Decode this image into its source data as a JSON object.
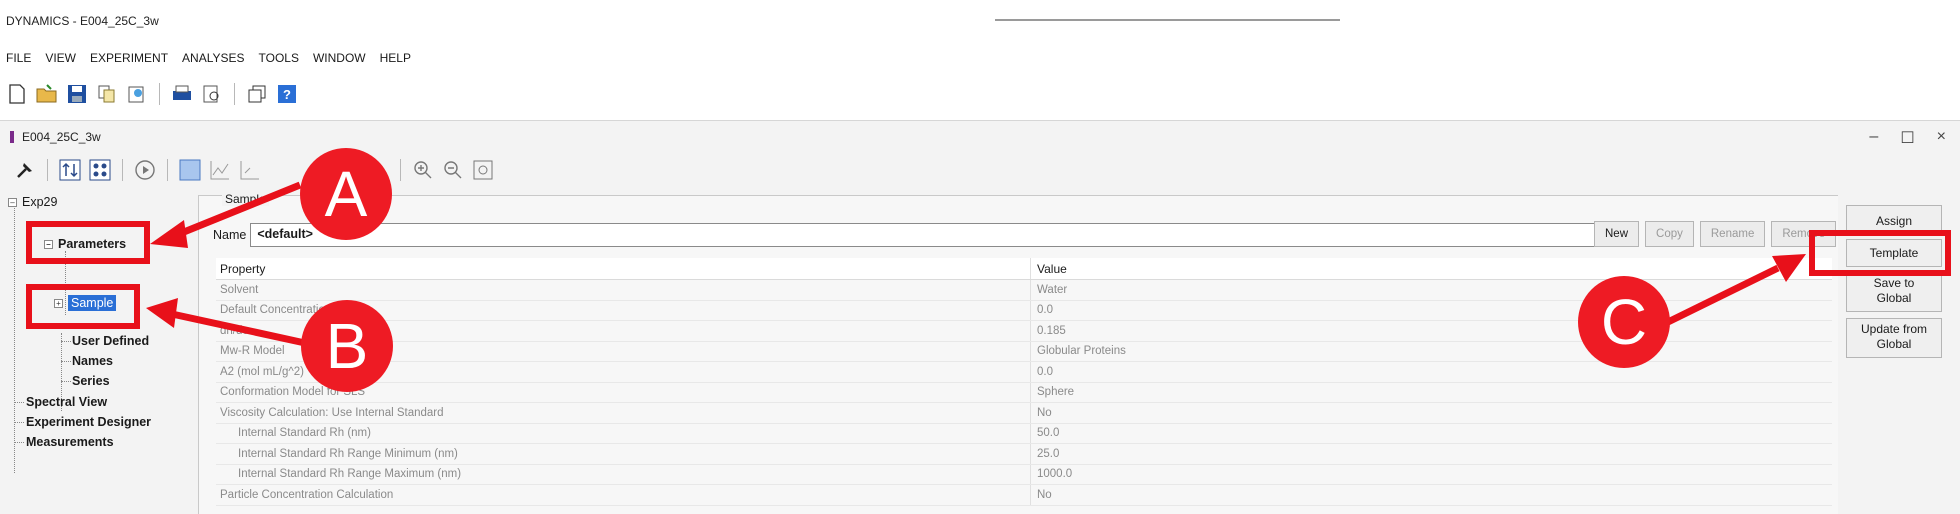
{
  "app": {
    "title": "DYNAMICS - E004_25C_3w"
  },
  "menu": [
    "FILE",
    "VIEW",
    "EXPERIMENT",
    "ANALYSES",
    "TOOLS",
    "WINDOW",
    "HELP"
  ],
  "document": {
    "title": "E004_25C_3w",
    "controls": [
      "–",
      "☐",
      "×"
    ]
  },
  "tree": {
    "root": "Exp29",
    "parameters": "Parameters",
    "sample": "Sample",
    "user_defined": "User Defined",
    "names": "Names",
    "series": "Series",
    "spectral_view": "Spectral View",
    "experiment_designer": "Experiment Designer",
    "measurements": "Measurements"
  },
  "panel": {
    "group_label": "Sample",
    "name_label": "Name",
    "name_value": "<default>",
    "buttons": {
      "new": "New",
      "copy": "Copy",
      "rename": "Rename",
      "remove": "Remove"
    }
  },
  "grid": {
    "headers": {
      "property": "Property",
      "value": "Value"
    },
    "rows": [
      {
        "property": "Solvent",
        "value": "Water",
        "indent": false
      },
      {
        "property": "Default Concentration",
        "value": "0.0",
        "indent": false
      },
      {
        "property": "dn/dc",
        "value": "0.185",
        "indent": false
      },
      {
        "property": "Mw-R Model",
        "value": "Globular Proteins",
        "indent": false
      },
      {
        "property": "A2 (mol mL/g^2)",
        "value": "0.0",
        "indent": false
      },
      {
        "property": "Conformation Model for SLS",
        "value": "Sphere",
        "indent": false
      },
      {
        "property": "Viscosity Calculation: Use Internal Standard",
        "value": "No",
        "indent": false
      },
      {
        "property": "Internal Standard Rh (nm)",
        "value": "50.0",
        "indent": true
      },
      {
        "property": "Internal Standard Rh Range Minimum (nm)",
        "value": "25.0",
        "indent": true
      },
      {
        "property": "Internal Standard Rh Range Maximum (nm)",
        "value": "1000.0",
        "indent": true
      },
      {
        "property": "Particle Concentration Calculation",
        "value": "No",
        "indent": false
      }
    ]
  },
  "right_buttons": {
    "assign": "Assign",
    "template": "Template",
    "save_to_global": "Save to\nGlobal",
    "update_from_global": "Update from\nGlobal"
  },
  "callouts": {
    "a": "A",
    "b": "B",
    "c": "C"
  },
  "colors": {
    "annotation_red": "#e8101a",
    "selection_blue": "#2a6fd6"
  }
}
